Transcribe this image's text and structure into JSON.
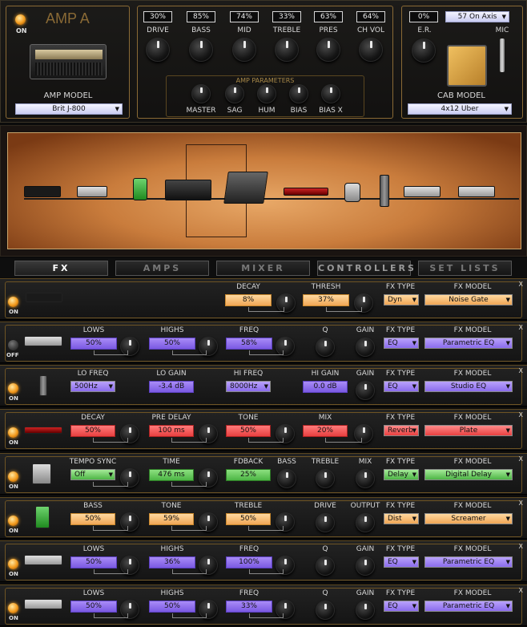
{
  "amp": {
    "title": "AMP A",
    "power_label": "ON",
    "model_label": "AMP MODEL",
    "model_value": "Brit J-800",
    "knobs": [
      {
        "label": "DRIVE",
        "value": "30%"
      },
      {
        "label": "BASS",
        "value": "85%"
      },
      {
        "label": "MID",
        "value": "74%"
      },
      {
        "label": "TREBLE",
        "value": "33%"
      },
      {
        "label": "PRES",
        "value": "63%"
      },
      {
        "label": "CH VOL",
        "value": "64%"
      }
    ],
    "params_title": "AMP PARAMETERS",
    "params": [
      "MASTER",
      "SAG",
      "HUM",
      "BIAS",
      "BIAS X"
    ],
    "er_label": "E.R.",
    "er_value": "0%",
    "mic_value": "57 On Axis",
    "mic_label": "MIC",
    "cab_label": "CAB MODEL",
    "cab_value": "4x12 Uber"
  },
  "tabs": [
    "FX",
    "AMPS",
    "MIXER",
    "CONTROLLERS",
    "SET LISTS"
  ],
  "fx_rows": [
    {
      "power": "ON",
      "params": [
        {
          "label": "DECAY",
          "value": "8%"
        },
        {
          "label": "THRESH",
          "value": "37%"
        }
      ],
      "fx_type_label": "FX TYPE",
      "fx_type": "Dyn",
      "fx_model_label": "FX MODEL",
      "fx_model": "Noise Gate"
    },
    {
      "power": "OFF",
      "params": [
        {
          "label": "LOWS",
          "value": "50%"
        },
        {
          "label": "HIGHS",
          "value": "50%"
        },
        {
          "label": "FREQ",
          "value": "58%"
        },
        {
          "label": "Q",
          "value": ""
        },
        {
          "label": "GAIN",
          "value": ""
        }
      ],
      "fx_type_label": "FX TYPE",
      "fx_type": "EQ",
      "fx_model_label": "FX MODEL",
      "fx_model": "Parametric EQ"
    },
    {
      "power": "ON",
      "params": [
        {
          "label": "LO FREQ",
          "value": "500Hz"
        },
        {
          "label": "LO GAIN",
          "value": "-3.4 dB"
        },
        {
          "label": "HI FREQ",
          "value": "8000Hz"
        },
        {
          "label": "HI GAIN",
          "value": "0.0 dB"
        },
        {
          "label": "GAIN",
          "value": ""
        }
      ],
      "fx_type_label": "FX TYPE",
      "fx_type": "EQ",
      "fx_model_label": "FX MODEL",
      "fx_model": "Studio EQ"
    },
    {
      "power": "ON",
      "params": [
        {
          "label": "DECAY",
          "value": "50%"
        },
        {
          "label": "PRE DELAY",
          "value": "100 ms"
        },
        {
          "label": "TONE",
          "value": "50%"
        },
        {
          "label": "MIX",
          "value": "20%"
        }
      ],
      "fx_type_label": "FX TYPE",
      "fx_type": "Reverb",
      "fx_model_label": "FX MODEL",
      "fx_model": "Plate"
    },
    {
      "power": "ON",
      "params": [
        {
          "label": "TEMPO SYNC",
          "value": "Off"
        },
        {
          "label": "TIME",
          "value": "476 ms"
        },
        {
          "label": "FDBACK",
          "value": "25%"
        },
        {
          "label": "BASS",
          "value": ""
        },
        {
          "label": "TREBLE",
          "value": ""
        },
        {
          "label": "MIX",
          "value": ""
        }
      ],
      "fx_type_label": "FX TYPE",
      "fx_type": "Delay",
      "fx_model_label": "FX MODEL",
      "fx_model": "Digital Delay"
    },
    {
      "power": "ON",
      "params": [
        {
          "label": "BASS",
          "value": "50%"
        },
        {
          "label": "TONE",
          "value": "59%"
        },
        {
          "label": "TREBLE",
          "value": "50%"
        },
        {
          "label": "DRIVE",
          "value": ""
        },
        {
          "label": "OUTPUT",
          "value": ""
        }
      ],
      "fx_type_label": "FX TYPE",
      "fx_type": "Dist",
      "fx_model_label": "FX MODEL",
      "fx_model": "Screamer"
    },
    {
      "power": "ON",
      "params": [
        {
          "label": "LOWS",
          "value": "50%"
        },
        {
          "label": "HIGHS",
          "value": "36%"
        },
        {
          "label": "FREQ",
          "value": "100%"
        },
        {
          "label": "Q",
          "value": ""
        },
        {
          "label": "GAIN",
          "value": ""
        }
      ],
      "fx_type_label": "FX TYPE",
      "fx_type": "EQ",
      "fx_model_label": "FX MODEL",
      "fx_model": "Parametric EQ"
    },
    {
      "power": "ON",
      "params": [
        {
          "label": "LOWS",
          "value": "50%"
        },
        {
          "label": "HIGHS",
          "value": "50%"
        },
        {
          "label": "FREQ",
          "value": "33%"
        },
        {
          "label": "Q",
          "value": ""
        },
        {
          "label": "GAIN",
          "value": ""
        }
      ],
      "fx_type_label": "FX TYPE",
      "fx_type": "EQ",
      "fx_model_label": "FX MODEL",
      "fx_model": "Parametric EQ"
    }
  ],
  "colors": {
    "gold": "#8a6a35",
    "orange": "#f0a655",
    "purple": "#7a59e2",
    "red": "#e84040",
    "green": "#4cb544"
  }
}
